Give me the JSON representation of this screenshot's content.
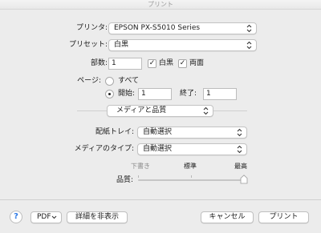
{
  "window": {
    "title": "プリント"
  },
  "printer": {
    "label": "プリンタ:",
    "value": "EPSON PX-S5010 Series"
  },
  "presets": {
    "label": "プリセット:",
    "value": "白黒"
  },
  "copies": {
    "label": "部数:",
    "value": "1",
    "bw_label": "白黒",
    "bw_checked": true,
    "duplex_label": "両面",
    "duplex_checked": true
  },
  "pages": {
    "label": "ページ:",
    "all_label": "すべて",
    "range_selected": true,
    "from_label": "開始:",
    "from_value": "1",
    "to_label": "終了:",
    "to_value": "1"
  },
  "section": {
    "value": "メディアと品質"
  },
  "tray": {
    "label": "配紙トレイ:",
    "value": "自動選択"
  },
  "media_type": {
    "label": "メディアのタイプ:",
    "value": "自動選択"
  },
  "quality": {
    "label": "品質:",
    "marks": [
      "下書き",
      "標準",
      "最高"
    ],
    "level": 1.0
  },
  "footer": {
    "help": "?",
    "pdf": "PDF",
    "details": "詳細を非表示",
    "cancel": "キャンセル",
    "print": "プリント"
  },
  "icons": {
    "popup": "chevron-updown-icon",
    "pdf_menu": "chevron-down-icon",
    "help": "help-icon"
  }
}
